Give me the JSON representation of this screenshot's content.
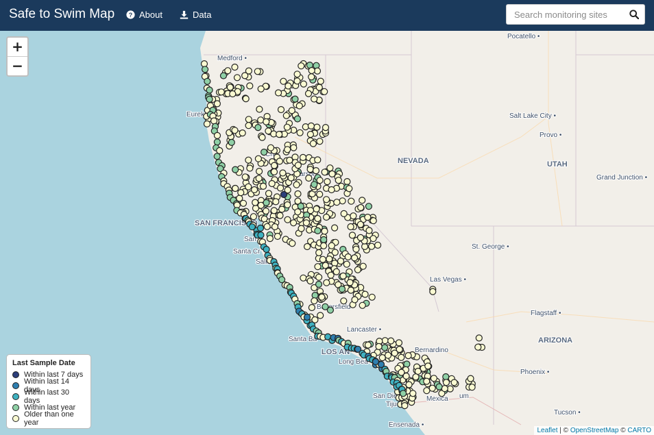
{
  "header": {
    "brand": "Safe to Swim Map",
    "about_label": "About",
    "data_label": "Data",
    "search_placeholder": "Search monitoring sites"
  },
  "zoom": {
    "in_label": "+",
    "out_label": "−"
  },
  "legend": {
    "title": "Last Sample Date",
    "items": [
      {
        "label": "Within last 7 days",
        "color": "#2c3e7a"
      },
      {
        "label": "Within last 14 days",
        "color": "#2f7fb0"
      },
      {
        "label": "Within last 30 days",
        "color": "#3fb1c0"
      },
      {
        "label": "Within last year",
        "color": "#8fd0a6"
      },
      {
        "label": "Older than one year",
        "color": "#fafad2"
      }
    ]
  },
  "attribution": {
    "leaflet": "Leaflet",
    "osm": "OpenStreetMap",
    "carto": "CARTO",
    "sep1": " | © ",
    "sep2": " © "
  },
  "colors": {
    "water": "#aad3df",
    "land": "#f2efe9",
    "header": "#1b3a5c"
  },
  "place_labels": {
    "pocatello": "Pocatello",
    "medford": "Medford",
    "eureka": "Eureka",
    "salt_lake_city": "Salt Lake City",
    "provo": "Provo",
    "nevada": "NEVADA",
    "utah": "UTAH",
    "grand_junction": "Grand Junction",
    "san_francisco": "SAN FRANCISCO",
    "santa_cruz": "Santa Cr",
    "salinas": "Salin",
    "st_george": "St. George",
    "las_vegas": "Las Vegas",
    "flagstaff": "Flagstaff",
    "arizona": "ARIZONA",
    "bakersfield": "Bakersfield",
    "lancaster": "Lancaster",
    "santa_barbara": "Santa Ba",
    "los_angeles": "LOS AN",
    "long_beach": "Long Bea",
    "san_bernardino": "Bernardino",
    "phoenix": "Phoenix",
    "san_diego": "San Dieg",
    "tijuana": "Tiju",
    "mexicali": "Mexica",
    "tucson": "Tucson",
    "ensenada": "Ensenada",
    "carson": "arson",
    "chico": "Chi",
    "san_prefix": "San",
    "yuma": "um"
  }
}
